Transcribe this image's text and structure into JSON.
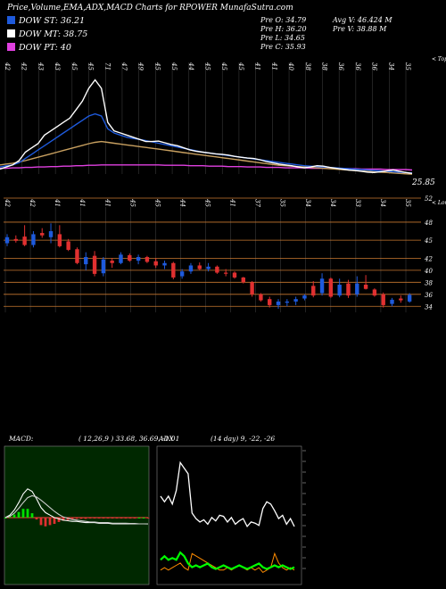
{
  "header": {
    "title": "Price,Volume,EMA,ADX,MACD Charts for RPOWER MunafaSutra.com"
  },
  "legend": [
    {
      "label": "DOW ST: 36.21",
      "color": "#1e5adc"
    },
    {
      "label": "DOW MT: 38.75",
      "color": "#ffffff"
    },
    {
      "label": "DOW PT: 40",
      "color": "#e040e0"
    }
  ],
  "stats": {
    "pre_o": "Pre  O: 34.79",
    "pre_h": "Pre  H: 36.20",
    "pre_l": "Pre  L: 34.65",
    "pre_c": "Pre  C: 35.93",
    "avg_v": "Avg V: 46.424  M",
    "pre_v": "Pre  V: 38.88  M"
  },
  "chart_data": [
    {
      "type": "line",
      "name": "ema_panel",
      "top_axis_label": "< Tops",
      "top_labels": [
        "42",
        "42",
        "43",
        "43",
        "45",
        "45",
        "71",
        "47",
        "49",
        "45",
        "45",
        "44",
        "45",
        "45",
        "45",
        "41",
        "41",
        "40",
        "38",
        "38",
        "36",
        "36",
        "36",
        "34",
        "35"
      ],
      "last_value_label": "25.85",
      "series": [
        {
          "color": "#ffffff",
          "values": [
            36,
            36.5,
            37,
            38,
            40,
            41,
            42,
            44,
            45,
            46,
            47,
            48,
            50,
            52,
            55,
            57,
            55,
            47,
            45,
            44.5,
            44,
            43.5,
            43,
            42.5,
            42.5,
            42.6,
            42.2,
            41.8,
            41.5,
            41,
            40.5,
            40.2,
            40,
            39.8,
            39.6,
            39.5,
            39.3,
            39,
            38.8,
            38.6,
            38.5,
            38.2,
            37.8,
            37.5,
            37.2,
            37,
            36.8,
            36.5,
            36.3,
            36.5,
            36.8,
            36.7,
            36.4,
            36.2,
            36,
            35.8,
            35.7,
            35.5,
            35.3,
            35.2,
            35.4,
            35.6,
            35.8,
            35.5,
            35.2,
            35
          ]
        },
        {
          "color": "#1e5adc",
          "values": [
            36.5,
            36.8,
            37,
            37.5,
            38.5,
            39.5,
            40.5,
            41.5,
            42.5,
            43.5,
            44.5,
            45.5,
            46.5,
            47.5,
            48.5,
            49,
            48.5,
            45.5,
            44.5,
            44,
            43.5,
            43.2,
            43,
            42.7,
            42.4,
            42.1,
            41.8,
            41.5,
            41.2,
            40.9,
            40.6,
            40.3,
            40,
            39.8,
            39.6,
            39.4,
            39.2,
            39,
            38.8,
            38.6,
            38.4,
            38.2,
            38,
            37.8,
            37.6,
            37.4,
            37.2,
            37,
            36.8,
            36.7,
            36.6,
            36.5,
            36.4,
            36.3,
            36.2,
            36.1,
            36,
            35.9,
            35.8,
            35.7,
            35.6,
            35.5,
            35.4,
            35.3,
            35.2,
            35.1
          ]
        },
        {
          "color": "#c8a060",
          "values": [
            37,
            37.2,
            37.4,
            37.7,
            38,
            38.4,
            38.8,
            39.2,
            39.6,
            40,
            40.4,
            40.8,
            41.2,
            41.6,
            42,
            42.3,
            42.5,
            42.3,
            42.1,
            41.9,
            41.7,
            41.5,
            41.3,
            41.1,
            40.9,
            40.7,
            40.5,
            40.3,
            40.1,
            39.9,
            39.7,
            39.5,
            39.3,
            39.1,
            38.9,
            38.7,
            38.5,
            38.3,
            38.1,
            37.9,
            37.7,
            37.5,
            37.3,
            37.1,
            36.9,
            36.8,
            36.7,
            36.6,
            36.5,
            36.4,
            36.3,
            36.2,
            36.1,
            36,
            35.9,
            35.8,
            35.7,
            35.6,
            35.5,
            35.4,
            35.3,
            35.2,
            35.1,
            35,
            34.9,
            34.8
          ]
        },
        {
          "color": "#e040e0",
          "values": [
            36.2,
            36.2,
            36.3,
            36.3,
            36.4,
            36.4,
            36.5,
            36.5,
            36.6,
            36.6,
            36.7,
            36.7,
            36.8,
            36.8,
            36.9,
            36.9,
            37,
            37,
            37,
            37,
            37,
            37,
            37,
            37,
            37,
            37,
            36.9,
            36.9,
            36.9,
            36.9,
            36.8,
            36.8,
            36.8,
            36.7,
            36.7,
            36.7,
            36.6,
            36.6,
            36.6,
            36.5,
            36.5,
            36.5,
            36.4,
            36.4,
            36.4,
            36.3,
            36.3,
            36.3,
            36.3,
            36.2,
            36.2,
            36.2,
            36.2,
            36.1,
            36.1,
            36.1,
            36.1,
            36,
            36,
            36,
            36,
            35.9,
            35.9,
            35.9,
            35.9,
            35.8
          ]
        }
      ]
    },
    {
      "type": "candlestick",
      "name": "price_panel",
      "bottom_axis_label": "< Lows",
      "low_labels": [
        "42",
        "42",
        "41",
        "41",
        "41",
        "45",
        "45",
        "44",
        "45",
        "41",
        "37",
        "35",
        "34",
        "34",
        "33",
        "34",
        "35"
      ],
      "y_ticks": [
        52,
        48,
        45,
        42,
        40,
        38,
        36,
        34
      ],
      "ylim": [
        33,
        52
      ],
      "candles": [
        {
          "o": 44.5,
          "h": 46,
          "l": 44,
          "c": 45.5,
          "up": true
        },
        {
          "o": 45.2,
          "h": 45.8,
          "l": 44.6,
          "c": 44.9,
          "up": false
        },
        {
          "o": 45.6,
          "h": 47.5,
          "l": 44,
          "c": 44.2,
          "up": false
        },
        {
          "o": 44.2,
          "h": 46.5,
          "l": 43.8,
          "c": 46,
          "up": true
        },
        {
          "o": 46.2,
          "h": 47,
          "l": 45.4,
          "c": 45.8,
          "up": false
        },
        {
          "o": 45.5,
          "h": 47.8,
          "l": 44.5,
          "c": 46.5,
          "up": true
        },
        {
          "o": 46,
          "h": 47.5,
          "l": 43.8,
          "c": 44,
          "up": false
        },
        {
          "o": 44.8,
          "h": 45.2,
          "l": 43.2,
          "c": 43.4,
          "up": false
        },
        {
          "o": 43.5,
          "h": 43.8,
          "l": 41,
          "c": 41.2,
          "up": false
        },
        {
          "o": 41,
          "h": 43,
          "l": 40,
          "c": 42.2,
          "up": true
        },
        {
          "o": 42.4,
          "h": 43.2,
          "l": 39,
          "c": 39.4,
          "up": false
        },
        {
          "o": 39.5,
          "h": 42.2,
          "l": 39,
          "c": 41.8,
          "up": true
        },
        {
          "o": 41.6,
          "h": 42,
          "l": 40.4,
          "c": 41.2,
          "up": false
        },
        {
          "o": 41.2,
          "h": 43,
          "l": 41,
          "c": 42.6,
          "up": true
        },
        {
          "o": 42.5,
          "h": 42.8,
          "l": 41.4,
          "c": 41.6,
          "up": false
        },
        {
          "o": 41.6,
          "h": 42.6,
          "l": 41,
          "c": 42.2,
          "up": true
        },
        {
          "o": 42.2,
          "h": 42.4,
          "l": 41.2,
          "c": 41.4,
          "up": false
        },
        {
          "o": 41.5,
          "h": 42,
          "l": 40.4,
          "c": 40.8,
          "up": false
        },
        {
          "o": 40.8,
          "h": 41.6,
          "l": 40.2,
          "c": 41.2,
          "up": true
        },
        {
          "o": 41.2,
          "h": 41.4,
          "l": 38.5,
          "c": 38.8,
          "up": false
        },
        {
          "o": 39,
          "h": 40.2,
          "l": 38.6,
          "c": 39.8,
          "up": true
        },
        {
          "o": 39.8,
          "h": 41.2,
          "l": 39.4,
          "c": 40.8,
          "up": true
        },
        {
          "o": 40.8,
          "h": 41.3,
          "l": 40,
          "c": 40.2,
          "up": false
        },
        {
          "o": 40.2,
          "h": 41.2,
          "l": 39.8,
          "c": 40.6,
          "up": true
        },
        {
          "o": 40.6,
          "h": 40.8,
          "l": 39.4,
          "c": 39.6,
          "up": false
        },
        {
          "o": 39.6,
          "h": 40.2,
          "l": 39,
          "c": 39.6,
          "up": false
        },
        {
          "o": 39.6,
          "h": 39.8,
          "l": 38.6,
          "c": 38.8,
          "up": false
        },
        {
          "o": 38.8,
          "h": 38.9,
          "l": 37.8,
          "c": 38,
          "up": false
        },
        {
          "o": 38,
          "h": 38.2,
          "l": 35.6,
          "c": 36,
          "up": false
        },
        {
          "o": 36,
          "h": 36.2,
          "l": 34.8,
          "c": 35,
          "up": false
        },
        {
          "o": 35.2,
          "h": 35.6,
          "l": 33.8,
          "c": 34.2,
          "up": false
        },
        {
          "o": 34.2,
          "h": 35.2,
          "l": 33.6,
          "c": 34.8,
          "up": true
        },
        {
          "o": 34.6,
          "h": 35.2,
          "l": 34,
          "c": 34.8,
          "up": true
        },
        {
          "o": 34.8,
          "h": 35.6,
          "l": 34.2,
          "c": 35.2,
          "up": true
        },
        {
          "o": 35.3,
          "h": 36,
          "l": 35,
          "c": 35.8,
          "up": true
        },
        {
          "o": 35.8,
          "h": 38.2,
          "l": 35.5,
          "c": 37.4,
          "up": false
        },
        {
          "o": 36.2,
          "h": 39.5,
          "l": 35.8,
          "c": 38.6,
          "up": true
        },
        {
          "o": 38.6,
          "h": 38.8,
          "l": 35.4,
          "c": 35.6,
          "up": false
        },
        {
          "o": 35.8,
          "h": 38.6,
          "l": 35.5,
          "c": 37.6,
          "up": true
        },
        {
          "o": 37.8,
          "h": 38.4,
          "l": 35.4,
          "c": 35.8,
          "up": false
        },
        {
          "o": 36,
          "h": 39,
          "l": 35.6,
          "c": 37.8,
          "up": true
        },
        {
          "o": 37.6,
          "h": 39.2,
          "l": 36.8,
          "c": 36.9,
          "up": false
        },
        {
          "o": 36.8,
          "h": 37,
          "l": 35.6,
          "c": 35.8,
          "up": false
        },
        {
          "o": 36,
          "h": 36.3,
          "l": 33.8,
          "c": 34.2,
          "up": false
        },
        {
          "o": 34.4,
          "h": 35.4,
          "l": 34,
          "c": 35.1,
          "up": true
        },
        {
          "o": 35,
          "h": 35.8,
          "l": 34.6,
          "c": 35.3,
          "up": false
        },
        {
          "o": 34.8,
          "h": 36.2,
          "l": 34.6,
          "c": 35.9,
          "up": true
        }
      ]
    },
    {
      "type": "line",
      "name": "macd_panel",
      "label": "MACD",
      "params": "( 12,26,9 ) 33.68,  36.69,  -1.01",
      "series": [
        {
          "color": "#ffffff",
          "values": [
            0,
            0.4,
            1.2,
            2.4,
            3.8,
            4.6,
            4.2,
            3,
            1.6,
            0.8,
            0.4,
            0,
            -0.2,
            -0.4,
            -0.5,
            -0.6,
            -0.6,
            -0.7,
            -0.8,
            -0.8,
            -0.8,
            -0.9,
            -0.9,
            -0.9,
            -1,
            -1,
            -1,
            -1,
            -1,
            -1,
            -1,
            -1,
            -1.01
          ]
        },
        {
          "color": "#cccccc",
          "values": [
            0,
            0.2,
            0.7,
            1.5,
            2.4,
            3.2,
            3.5,
            3.3,
            2.8,
            2.2,
            1.6,
            1,
            0.5,
            0.1,
            -0.1,
            -0.3,
            -0.4,
            -0.5,
            -0.6,
            -0.7,
            -0.7,
            -0.8,
            -0.8,
            -0.8,
            -0.9,
            -0.9,
            -0.9,
            -0.9,
            -0.95,
            -0.95,
            -1,
            -1,
            -1
          ]
        }
      ],
      "histogram": [
        0,
        0.2,
        0.5,
        0.9,
        1.4,
        1.4,
        0.7,
        -0.3,
        -1.2,
        -1.4,
        -1.2,
        -1,
        -0.7,
        -0.5,
        -0.4,
        -0.3,
        -0.2,
        -0.2,
        -0.2,
        -0.1,
        -0.1,
        -0.1,
        -0.1,
        -0.1,
        -0.1,
        -0.1,
        -0.1,
        -0.1,
        -0.05,
        -0.05,
        0,
        0,
        -0.01
      ]
    },
    {
      "type": "line",
      "name": "adx_panel",
      "label": "ADX",
      "params": "(14  day) 9,  -22,  -26",
      "series": [
        {
          "color": "#ffffff",
          "values": [
            55,
            50,
            55,
            48,
            60,
            85,
            80,
            75,
            40,
            35,
            32,
            34,
            30,
            36,
            33,
            38,
            37,
            32,
            36,
            30,
            33,
            35,
            28,
            32,
            31,
            29,
            44,
            50,
            48,
            42,
            35,
            38,
            30,
            35,
            28
          ]
        },
        {
          "color": "#00ff00",
          "values": [
            12,
            14,
            12,
            13,
            12,
            16,
            14,
            10,
            8,
            9,
            8,
            9,
            10,
            8,
            7,
            8,
            9,
            8,
            7,
            8,
            9,
            8,
            7,
            8,
            9,
            10,
            8,
            7,
            8,
            9,
            8,
            9,
            8,
            7,
            8
          ]
        },
        {
          "color": "#ff8c00",
          "values": [
            5,
            6,
            5,
            6,
            7,
            8,
            6,
            5,
            12,
            11,
            10,
            9,
            8,
            7,
            6,
            5,
            5,
            6,
            5,
            6,
            7,
            6,
            5,
            6,
            5,
            6,
            4,
            5,
            6,
            12,
            8,
            6,
            5,
            6,
            5
          ]
        }
      ]
    }
  ]
}
